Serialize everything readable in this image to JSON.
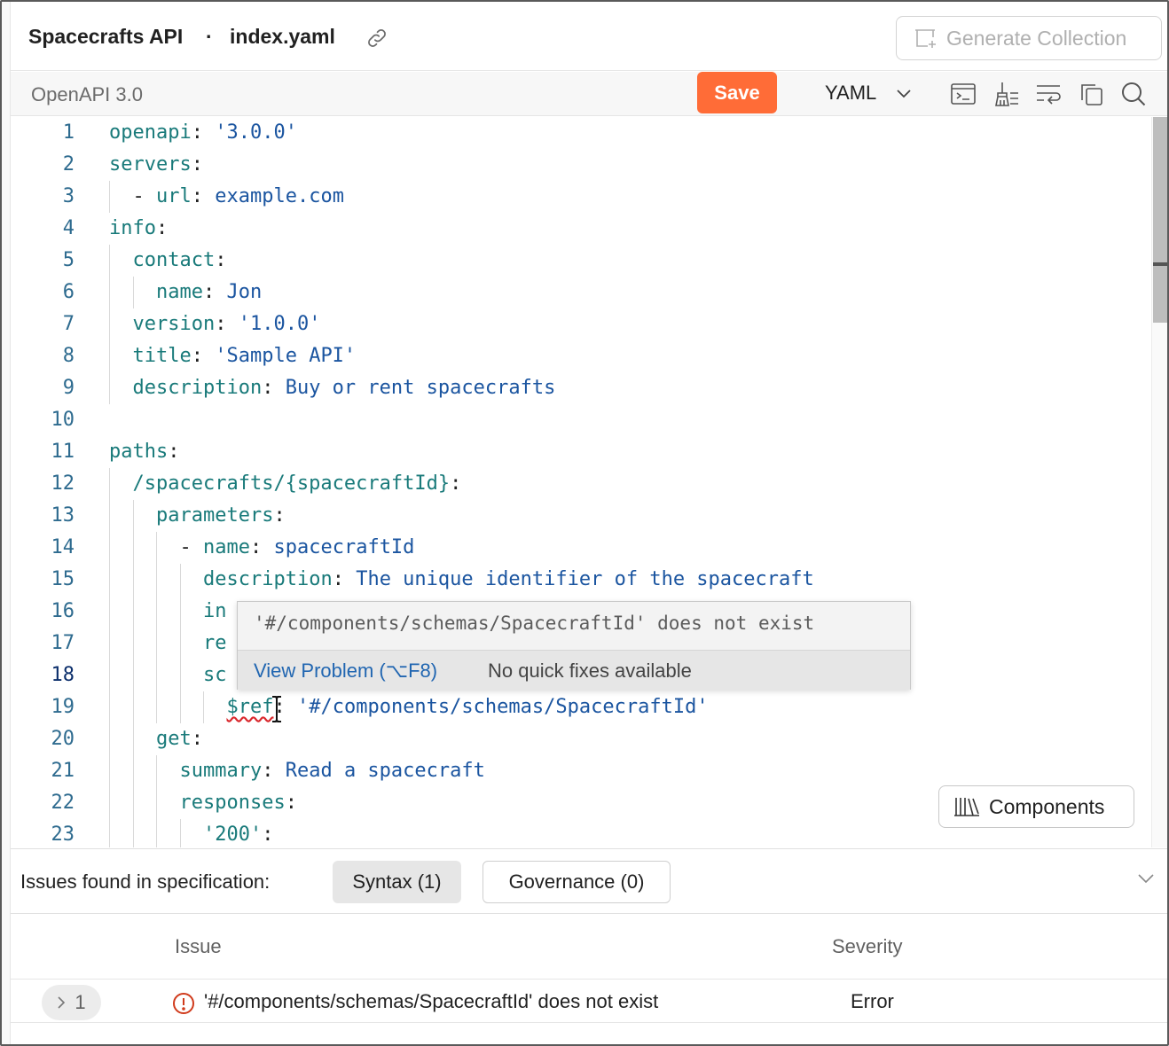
{
  "header": {
    "api_name": "Spacecrafts API",
    "separator": "·",
    "file_name": "index.yaml",
    "generate_label": "Generate Collection"
  },
  "toolbar": {
    "spec_version": "OpenAPI 3.0",
    "save_label": "Save",
    "format": "YAML",
    "icons": [
      "terminal-icon",
      "beautify-icon",
      "wrap-lines-icon",
      "copy-icon",
      "search-icon"
    ]
  },
  "colors": {
    "accent": "#ff6c37",
    "key": "#197a7a",
    "value": "#1b55a0",
    "error": "#d9262b",
    "link": "#2166b1"
  },
  "editor": {
    "lines": [
      {
        "n": "1",
        "indent": 0,
        "tokens": [
          {
            "t": "k",
            "s": "openapi"
          },
          {
            "t": "p",
            "s": ": "
          },
          {
            "t": "v",
            "s": "'3.0.0'"
          }
        ]
      },
      {
        "n": "2",
        "indent": 0,
        "tokens": [
          {
            "t": "k",
            "s": "servers"
          },
          {
            "t": "p",
            "s": ":"
          }
        ]
      },
      {
        "n": "3",
        "indent": 1,
        "tokens": [
          {
            "t": "p",
            "s": "- "
          },
          {
            "t": "k",
            "s": "url"
          },
          {
            "t": "p",
            "s": ": "
          },
          {
            "t": "v",
            "s": "example.com"
          }
        ]
      },
      {
        "n": "4",
        "indent": 0,
        "tokens": [
          {
            "t": "k",
            "s": "info"
          },
          {
            "t": "p",
            "s": ":"
          }
        ]
      },
      {
        "n": "5",
        "indent": 1,
        "tokens": [
          {
            "t": "k",
            "s": "contact"
          },
          {
            "t": "p",
            "s": ":"
          }
        ]
      },
      {
        "n": "6",
        "indent": 2,
        "tokens": [
          {
            "t": "k",
            "s": "name"
          },
          {
            "t": "p",
            "s": ": "
          },
          {
            "t": "v",
            "s": "Jon"
          }
        ]
      },
      {
        "n": "7",
        "indent": 1,
        "tokens": [
          {
            "t": "k",
            "s": "version"
          },
          {
            "t": "p",
            "s": ": "
          },
          {
            "t": "v",
            "s": "'1.0.0'"
          }
        ]
      },
      {
        "n": "8",
        "indent": 1,
        "tokens": [
          {
            "t": "k",
            "s": "title"
          },
          {
            "t": "p",
            "s": ": "
          },
          {
            "t": "v",
            "s": "'Sample API'"
          }
        ]
      },
      {
        "n": "9",
        "indent": 1,
        "tokens": [
          {
            "t": "k",
            "s": "description"
          },
          {
            "t": "p",
            "s": ": "
          },
          {
            "t": "v",
            "s": "Buy or rent spacecrafts"
          }
        ]
      },
      {
        "n": "10",
        "indent": 0,
        "tokens": []
      },
      {
        "n": "11",
        "indent": 0,
        "tokens": [
          {
            "t": "k",
            "s": "paths"
          },
          {
            "t": "p",
            "s": ":"
          }
        ]
      },
      {
        "n": "12",
        "indent": 1,
        "tokens": [
          {
            "t": "k",
            "s": "/spacecrafts/{spacecraftId}"
          },
          {
            "t": "p",
            "s": ":"
          }
        ]
      },
      {
        "n": "13",
        "indent": 2,
        "tokens": [
          {
            "t": "k",
            "s": "parameters"
          },
          {
            "t": "p",
            "s": ":"
          }
        ]
      },
      {
        "n": "14",
        "indent": 3,
        "tokens": [
          {
            "t": "p",
            "s": "- "
          },
          {
            "t": "k",
            "s": "name"
          },
          {
            "t": "p",
            "s": ": "
          },
          {
            "t": "v",
            "s": "spacecraftId"
          }
        ]
      },
      {
        "n": "15",
        "indent": 4,
        "tokens": [
          {
            "t": "k",
            "s": "description"
          },
          {
            "t": "p",
            "s": ": "
          },
          {
            "t": "v",
            "s": "The unique identifier of the spacecraft"
          }
        ]
      },
      {
        "n": "16",
        "indent": 4,
        "tokens": [
          {
            "t": "k",
            "s": "in"
          }
        ]
      },
      {
        "n": "17",
        "indent": 4,
        "tokens": [
          {
            "t": "k",
            "s": "re"
          }
        ]
      },
      {
        "n": "18",
        "indent": 4,
        "active": true,
        "tokens": [
          {
            "t": "k",
            "s": "sc"
          }
        ]
      },
      {
        "n": "19",
        "indent": 5,
        "tokens": [
          {
            "t": "k",
            "s": "$ref",
            "err": true
          },
          {
            "t": "p",
            "s": ": "
          },
          {
            "t": "v",
            "s": "'#/components/schemas/SpacecraftId'"
          }
        ]
      },
      {
        "n": "20",
        "indent": 2,
        "tokens": [
          {
            "t": "k",
            "s": "get"
          },
          {
            "t": "p",
            "s": ":"
          }
        ]
      },
      {
        "n": "21",
        "indent": 3,
        "tokens": [
          {
            "t": "k",
            "s": "summary"
          },
          {
            "t": "p",
            "s": ": "
          },
          {
            "t": "v",
            "s": "Read a spacecraft"
          }
        ]
      },
      {
        "n": "22",
        "indent": 3,
        "tokens": [
          {
            "t": "k",
            "s": "responses"
          },
          {
            "t": "p",
            "s": ":"
          }
        ]
      },
      {
        "n": "23",
        "indent": 4,
        "tokens": [
          {
            "t": "k",
            "s": "'200'"
          },
          {
            "t": "p",
            "s": ":"
          }
        ]
      }
    ]
  },
  "hover": {
    "message": "'#/components/schemas/SpacecraftId' does not exist",
    "view_problem": "View Problem (⌥F8)",
    "no_fixes": "No quick fixes available"
  },
  "components_label": "Components",
  "issues": {
    "title": "Issues found in specification:",
    "syntax_tab": "Syntax (1)",
    "governance_tab": "Governance (0)",
    "col_issue": "Issue",
    "col_severity": "Severity",
    "rows": [
      {
        "index": "1",
        "message": "'#/components/schemas/SpacecraftId' does not exist",
        "severity": "Error"
      }
    ]
  }
}
